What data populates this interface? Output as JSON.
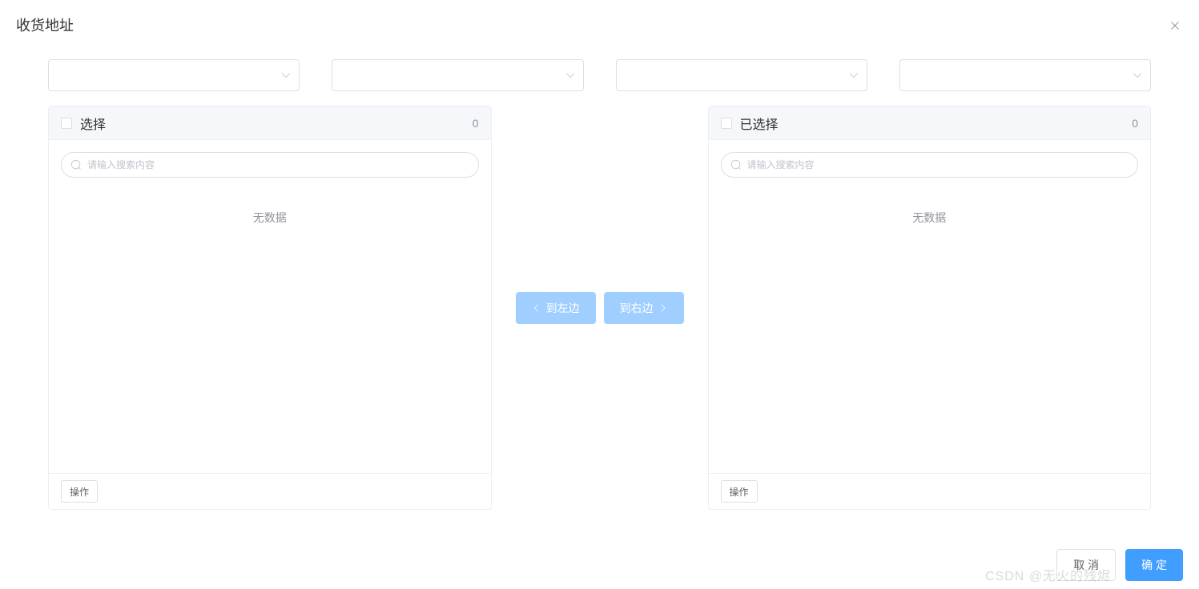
{
  "dialog": {
    "title": "收货地址"
  },
  "selects": [
    {
      "value": ""
    },
    {
      "value": ""
    },
    {
      "value": ""
    },
    {
      "value": ""
    }
  ],
  "transfer": {
    "left": {
      "title": "选择",
      "count": "0",
      "search_placeholder": "请输入搜索内容",
      "empty": "无数据",
      "footer_btn": "操作"
    },
    "right": {
      "title": "已选择",
      "count": "0",
      "search_placeholder": "请输入搜索内容",
      "empty": "无数据",
      "footer_btn": "操作"
    },
    "to_left": "到左边",
    "to_right": "到右边"
  },
  "footer": {
    "cancel": "取 消",
    "confirm": "确 定"
  },
  "watermark": "CSDN @无火的残烬"
}
